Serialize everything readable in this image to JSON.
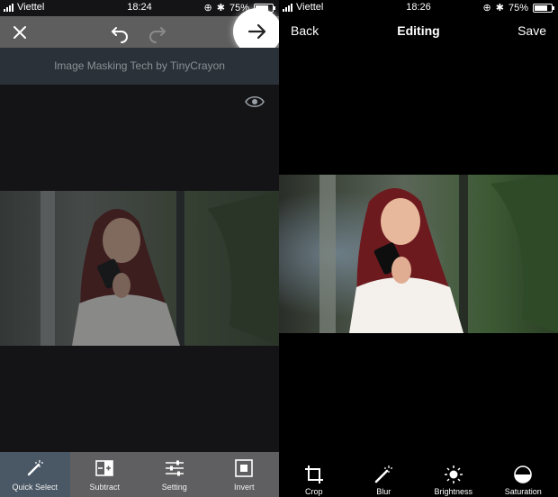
{
  "left": {
    "status": {
      "carrier": "Viettel",
      "time": "18:24",
      "battery": "75%",
      "battery_level": 0.75
    },
    "topbar": {
      "close_icon": "close-icon",
      "undo_icon": "undo-icon",
      "redo_icon": "redo-icon",
      "next_icon": "arrow-right-icon"
    },
    "title": "Image Masking Tech by TinyCrayon",
    "toolbar": [
      {
        "label": "Quick Select",
        "icon": "magic-wand-icon",
        "active": true
      },
      {
        "label": "Subtract",
        "icon": "subtract-icon",
        "active": false
      },
      {
        "label": "Setting",
        "icon": "sliders-icon",
        "active": false
      },
      {
        "label": "Invert",
        "icon": "invert-icon",
        "active": false
      }
    ]
  },
  "right": {
    "status": {
      "carrier": "Viettel",
      "time": "18:26",
      "battery": "75%",
      "battery_level": 0.75
    },
    "nav": {
      "back": "Back",
      "title": "Editing",
      "save": "Save"
    },
    "toolbar": [
      {
        "label": "Crop",
        "icon": "crop-icon"
      },
      {
        "label": "Blur",
        "icon": "magic-wand-icon"
      },
      {
        "label": "Brightness",
        "icon": "sun-icon"
      },
      {
        "label": "Saturation",
        "icon": "half-circle-icon"
      }
    ]
  },
  "colors": {
    "left_topbar": "#5e5e5e",
    "left_titlebar": "#2b3138",
    "toolbar_gray": "#5f5f61",
    "active_tool": "#4a5866"
  }
}
